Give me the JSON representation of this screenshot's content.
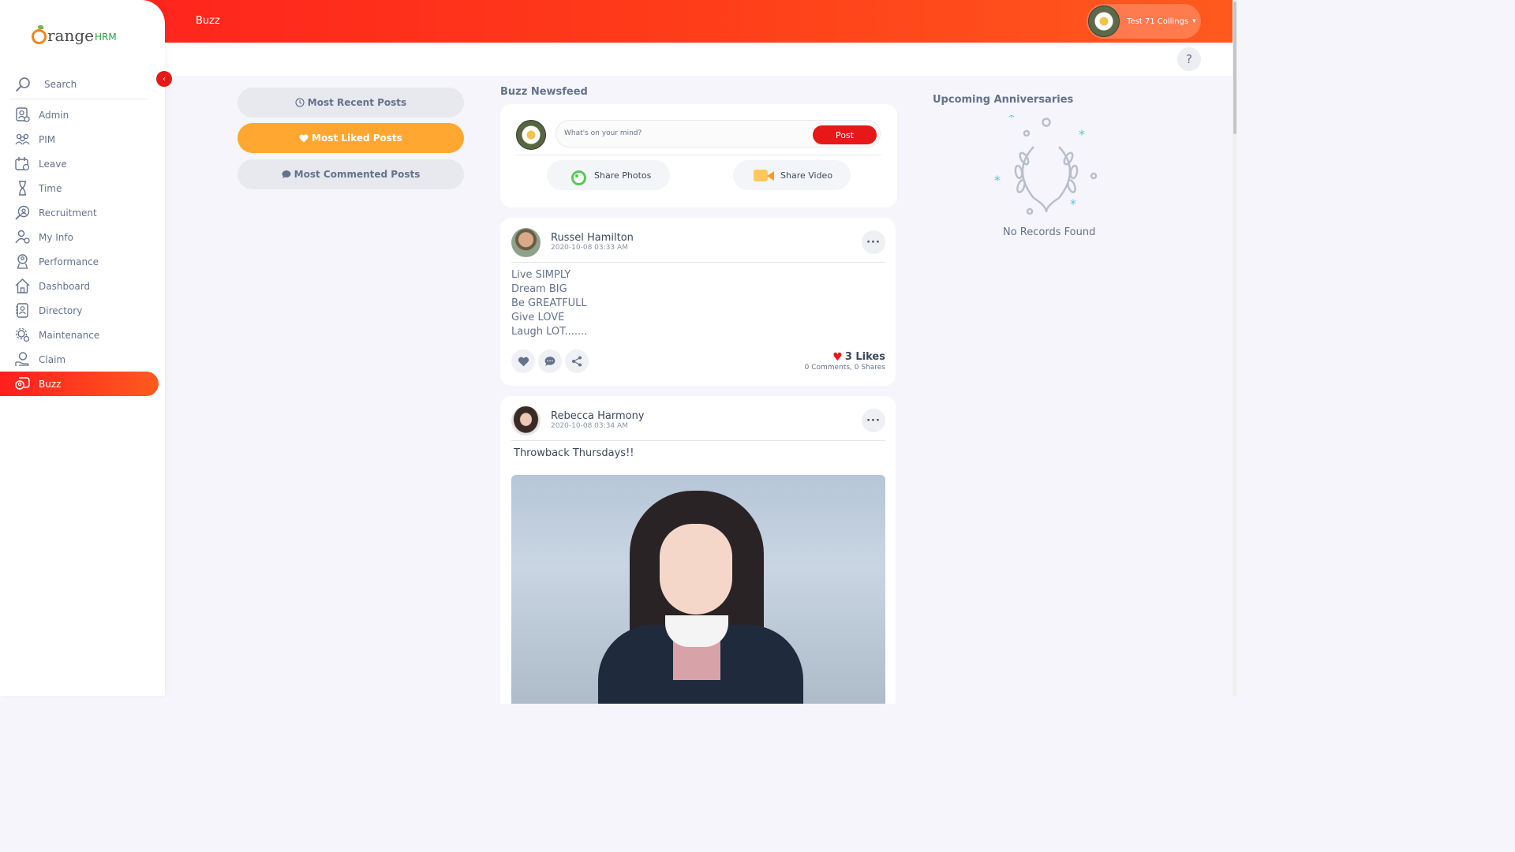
{
  "app": {
    "brand_word": "range",
    "brand_suffix": "HRM"
  },
  "topbar": {
    "breadcrumb": "Buzz",
    "user_name": "Test 71 Collings",
    "caret": "▾"
  },
  "help": {
    "label": "?"
  },
  "sidebar": {
    "collapse_icon": "‹",
    "search_label": "Search",
    "items": [
      {
        "label": "Admin",
        "icon": "admin-icon"
      },
      {
        "label": "PIM",
        "icon": "pim-icon"
      },
      {
        "label": "Leave",
        "icon": "leave-icon"
      },
      {
        "label": "Time",
        "icon": "time-icon"
      },
      {
        "label": "Recruitment",
        "icon": "recruitment-icon"
      },
      {
        "label": "My Info",
        "icon": "my-info-icon"
      },
      {
        "label": "Performance",
        "icon": "performance-icon"
      },
      {
        "label": "Dashboard",
        "icon": "dashboard-icon"
      },
      {
        "label": "Directory",
        "icon": "directory-icon"
      },
      {
        "label": "Maintenance",
        "icon": "maintenance-icon"
      },
      {
        "label": "Claim",
        "icon": "claim-icon"
      },
      {
        "label": "Buzz",
        "icon": "buzz-icon",
        "active": true
      }
    ],
    "active_color": "#ff1e1e"
  },
  "filters": {
    "recent": "Most Recent Posts",
    "liked": "Most Liked Posts",
    "commented": "Most Commented Posts",
    "active_color": "#ffa730"
  },
  "feed": {
    "title": "Buzz Newsfeed",
    "composer": {
      "placeholder": "What's on your mind?",
      "post_label": "Post",
      "share_photos": "Share Photos",
      "share_video": "Share Video"
    },
    "posts": [
      {
        "author": "Russel Hamilton",
        "date": "2020-10-08 03:33 AM",
        "lines": [
          "Live SIMPLY",
          "Dream BIG",
          "Be GREATFULL",
          "Give LOVE",
          "Laugh LOT......."
        ],
        "likes": "3 Likes",
        "comments": "0 Comments",
        "shares": "0 Shares"
      },
      {
        "author": "Rebecca Harmony",
        "date": "2020-10-08 03:34 AM",
        "text": "Throwback Thursdays!!"
      }
    ]
  },
  "anniversaries": {
    "title": "Upcoming Anniversaries",
    "empty": "No Records Found"
  }
}
